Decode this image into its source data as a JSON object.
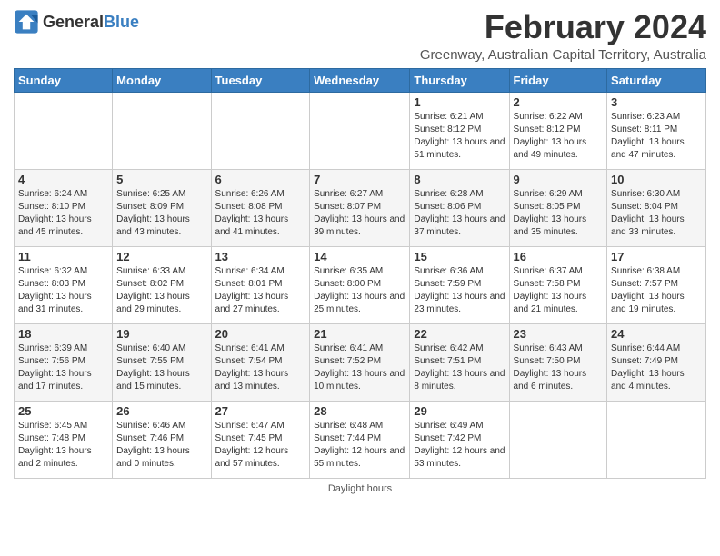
{
  "header": {
    "logo_general": "General",
    "logo_blue": "Blue",
    "main_title": "February 2024",
    "subtitle": "Greenway, Australian Capital Territory, Australia"
  },
  "calendar": {
    "headers": [
      "Sunday",
      "Monday",
      "Tuesday",
      "Wednesday",
      "Thursday",
      "Friday",
      "Saturday"
    ],
    "rows": [
      [
        {
          "day": "",
          "info": ""
        },
        {
          "day": "",
          "info": ""
        },
        {
          "day": "",
          "info": ""
        },
        {
          "day": "",
          "info": ""
        },
        {
          "day": "1",
          "info": "Sunrise: 6:21 AM\nSunset: 8:12 PM\nDaylight: 13 hours\nand 51 minutes."
        },
        {
          "day": "2",
          "info": "Sunrise: 6:22 AM\nSunset: 8:12 PM\nDaylight: 13 hours\nand 49 minutes."
        },
        {
          "day": "3",
          "info": "Sunrise: 6:23 AM\nSunset: 8:11 PM\nDaylight: 13 hours\nand 47 minutes."
        }
      ],
      [
        {
          "day": "4",
          "info": "Sunrise: 6:24 AM\nSunset: 8:10 PM\nDaylight: 13 hours\nand 45 minutes."
        },
        {
          "day": "5",
          "info": "Sunrise: 6:25 AM\nSunset: 8:09 PM\nDaylight: 13 hours\nand 43 minutes."
        },
        {
          "day": "6",
          "info": "Sunrise: 6:26 AM\nSunset: 8:08 PM\nDaylight: 13 hours\nand 41 minutes."
        },
        {
          "day": "7",
          "info": "Sunrise: 6:27 AM\nSunset: 8:07 PM\nDaylight: 13 hours\nand 39 minutes."
        },
        {
          "day": "8",
          "info": "Sunrise: 6:28 AM\nSunset: 8:06 PM\nDaylight: 13 hours\nand 37 minutes."
        },
        {
          "day": "9",
          "info": "Sunrise: 6:29 AM\nSunset: 8:05 PM\nDaylight: 13 hours\nand 35 minutes."
        },
        {
          "day": "10",
          "info": "Sunrise: 6:30 AM\nSunset: 8:04 PM\nDaylight: 13 hours\nand 33 minutes."
        }
      ],
      [
        {
          "day": "11",
          "info": "Sunrise: 6:32 AM\nSunset: 8:03 PM\nDaylight: 13 hours\nand 31 minutes."
        },
        {
          "day": "12",
          "info": "Sunrise: 6:33 AM\nSunset: 8:02 PM\nDaylight: 13 hours\nand 29 minutes."
        },
        {
          "day": "13",
          "info": "Sunrise: 6:34 AM\nSunset: 8:01 PM\nDaylight: 13 hours\nand 27 minutes."
        },
        {
          "day": "14",
          "info": "Sunrise: 6:35 AM\nSunset: 8:00 PM\nDaylight: 13 hours\nand 25 minutes."
        },
        {
          "day": "15",
          "info": "Sunrise: 6:36 AM\nSunset: 7:59 PM\nDaylight: 13 hours\nand 23 minutes."
        },
        {
          "day": "16",
          "info": "Sunrise: 6:37 AM\nSunset: 7:58 PM\nDaylight: 13 hours\nand 21 minutes."
        },
        {
          "day": "17",
          "info": "Sunrise: 6:38 AM\nSunset: 7:57 PM\nDaylight: 13 hours\nand 19 minutes."
        }
      ],
      [
        {
          "day": "18",
          "info": "Sunrise: 6:39 AM\nSunset: 7:56 PM\nDaylight: 13 hours\nand 17 minutes."
        },
        {
          "day": "19",
          "info": "Sunrise: 6:40 AM\nSunset: 7:55 PM\nDaylight: 13 hours\nand 15 minutes."
        },
        {
          "day": "20",
          "info": "Sunrise: 6:41 AM\nSunset: 7:54 PM\nDaylight: 13 hours\nand 13 minutes."
        },
        {
          "day": "21",
          "info": "Sunrise: 6:41 AM\nSunset: 7:52 PM\nDaylight: 13 hours\nand 10 minutes."
        },
        {
          "day": "22",
          "info": "Sunrise: 6:42 AM\nSunset: 7:51 PM\nDaylight: 13 hours\nand 8 minutes."
        },
        {
          "day": "23",
          "info": "Sunrise: 6:43 AM\nSunset: 7:50 PM\nDaylight: 13 hours\nand 6 minutes."
        },
        {
          "day": "24",
          "info": "Sunrise: 6:44 AM\nSunset: 7:49 PM\nDaylight: 13 hours\nand 4 minutes."
        }
      ],
      [
        {
          "day": "25",
          "info": "Sunrise: 6:45 AM\nSunset: 7:48 PM\nDaylight: 13 hours\nand 2 minutes."
        },
        {
          "day": "26",
          "info": "Sunrise: 6:46 AM\nSunset: 7:46 PM\nDaylight: 13 hours\nand 0 minutes."
        },
        {
          "day": "27",
          "info": "Sunrise: 6:47 AM\nSunset: 7:45 PM\nDaylight: 12 hours\nand 57 minutes."
        },
        {
          "day": "28",
          "info": "Sunrise: 6:48 AM\nSunset: 7:44 PM\nDaylight: 12 hours\nand 55 minutes."
        },
        {
          "day": "29",
          "info": "Sunrise: 6:49 AM\nSunset: 7:42 PM\nDaylight: 12 hours\nand 53 minutes."
        },
        {
          "day": "",
          "info": ""
        },
        {
          "day": "",
          "info": ""
        }
      ]
    ]
  },
  "footer": {
    "daylight_hours": "Daylight hours"
  }
}
